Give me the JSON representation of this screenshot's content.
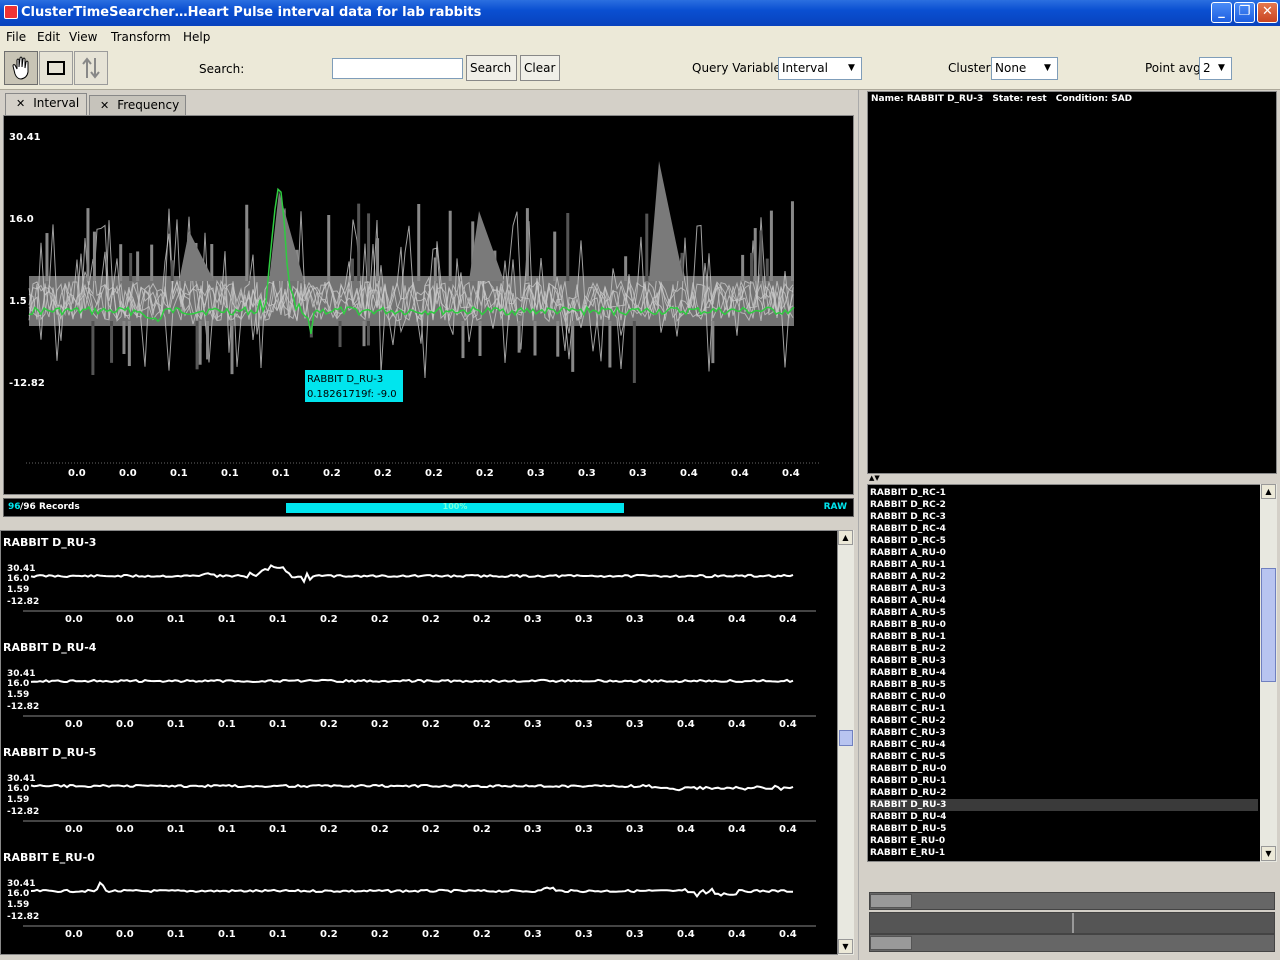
{
  "window": {
    "title": "ClusterTimeSearcher…Heart Pulse interval data for lab rabbits"
  },
  "menu": [
    "File",
    "Edit",
    "View",
    "Transform",
    "Help"
  ],
  "toolbar": {
    "search_label": "Search:",
    "search_value": "",
    "search_button": "Search",
    "clear_button": "Clear",
    "query_variable_label": "Query Variable",
    "query_variable_value": "Interval",
    "cluster_label": "Cluster",
    "cluster_value": "None",
    "point_avg_label": "Point avg",
    "point_avg_value": "2"
  },
  "tabs": [
    {
      "label": "Interval",
      "active": true
    },
    {
      "label": "Frequency",
      "active": false
    }
  ],
  "main_plot": {
    "y_ticks": [
      "30.41",
      "16.0",
      "1.5",
      "-12.82"
    ],
    "x_ticks": [
      "0.0",
      "0.0",
      "0.1",
      "0.1",
      "0.1",
      "0.2",
      "0.2",
      "0.2",
      "0.2",
      "0.3",
      "0.3",
      "0.3",
      "0.4",
      "0.4",
      "0.4"
    ],
    "tooltip_name": "RABBIT D_RU-3",
    "tooltip_value": "0.18261719f: -9.0",
    "highlight_color": "#2ecc40",
    "bundle_color": "#9a9a9a"
  },
  "status": {
    "records_shown": "96",
    "records_total": "/96 Records",
    "progress_label": "100%",
    "progress": 1.0,
    "mode": "RAW"
  },
  "small_multiples": {
    "y_ticks": [
      "30.41",
      "16.0",
      "1.59",
      "-12.82"
    ],
    "x_ticks": [
      "0.0",
      "0.0",
      "0.1",
      "0.1",
      "0.1",
      "0.2",
      "0.2",
      "0.2",
      "0.2",
      "0.3",
      "0.3",
      "0.3",
      "0.4",
      "0.4",
      "0.4"
    ],
    "records": [
      {
        "name": "RABBIT D_RU-3"
      },
      {
        "name": "RABBIT D_RU-4"
      },
      {
        "name": "RABBIT D_RU-5"
      },
      {
        "name": "RABBIT E_RU-0"
      }
    ]
  },
  "info": {
    "name_label": "Name:",
    "name_value": "RABBIT D_RU-3",
    "state_label": "State:",
    "state_value": "rest",
    "condition_label": "Condition:",
    "condition_value": "SAD"
  },
  "record_list": {
    "items": [
      "RABBIT D_RC-1",
      "RABBIT D_RC-2",
      "RABBIT D_RC-3",
      "RABBIT D_RC-4",
      "RABBIT D_RC-5",
      "RABBIT A_RU-0",
      "RABBIT A_RU-1",
      "RABBIT A_RU-2",
      "RABBIT A_RU-3",
      "RABBIT A_RU-4",
      "RABBIT A_RU-5",
      "RABBIT B_RU-0",
      "RABBIT B_RU-1",
      "RABBIT B_RU-2",
      "RABBIT B_RU-3",
      "RABBIT B_RU-4",
      "RABBIT B_RU-5",
      "RABBIT C_RU-0",
      "RABBIT C_RU-1",
      "RABBIT C_RU-2",
      "RABBIT C_RU-3",
      "RABBIT C_RU-4",
      "RABBIT C_RU-5",
      "RABBIT D_RU-0",
      "RABBIT D_RU-1",
      "RABBIT D_RU-2",
      "RABBIT D_RU-3",
      "RABBIT D_RU-4",
      "RABBIT D_RU-5",
      "RABBIT E_RU-0",
      "RABBIT E_RU-1"
    ],
    "selected": "RABBIT D_RU-3"
  }
}
